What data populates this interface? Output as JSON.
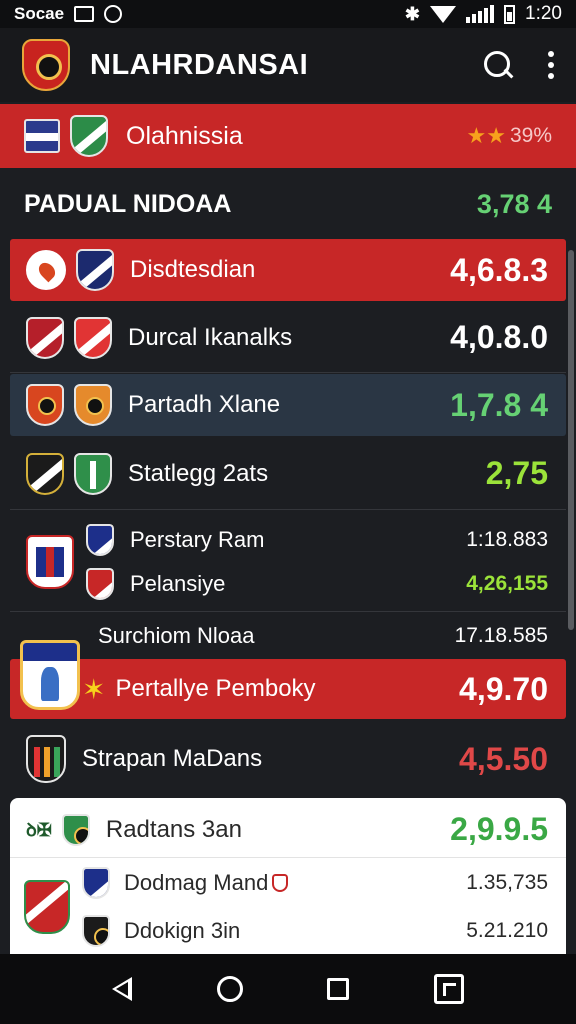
{
  "status_bar": {
    "left_text": "Socae",
    "time": "1:20"
  },
  "app_bar": {
    "title": "NLAHRDANSAI",
    "logo_icon": "club-crest-logo",
    "search_icon": "search-icon",
    "more_icon": "more-vert-icon"
  },
  "banner": {
    "label": "Olahnissia",
    "stars": "★★",
    "value": "39%"
  },
  "section": {
    "title": "PADUAL NIDOAA",
    "value": "3,78 4"
  },
  "rows": [
    {
      "name": "Disdtesdian",
      "value": "4,6.8.3"
    },
    {
      "name": "Durcal Ikanalks",
      "value": "4,0.8.0"
    },
    {
      "name": "Partadh Xlane",
      "value": "1,7.8 4"
    },
    {
      "name": "Statlegg 2ats",
      "value": "2,75"
    },
    {
      "name": "Perstary Ram",
      "value": "1:18.883"
    },
    {
      "name": "Pelansiye",
      "value": "4,26,155"
    },
    {
      "name": "Surchiom Nloaa",
      "value": "17.18.585"
    },
    {
      "name": "Pertallye Pemboky",
      "value": "4,9.70"
    },
    {
      "name": "Strapan MaDans",
      "value": "4,5.50"
    }
  ],
  "card_rows": [
    {
      "name": "Radtans 3an",
      "value": "2,9.9.5"
    },
    {
      "name": "Dodmag Mand",
      "value": "1.35,735"
    },
    {
      "name": "Ddokign 3in",
      "value": "5.21.210"
    }
  ],
  "colors": {
    "accent_red": "#c72727",
    "highlight_blue": "#2a3644",
    "value_green": "#66d174",
    "value_lime": "#9be33a"
  },
  "nav": {
    "back_icon": "back-icon",
    "home_icon": "home-icon",
    "recent_icon": "recent-apps-icon",
    "screenshot_icon": "screenshot-icon"
  }
}
